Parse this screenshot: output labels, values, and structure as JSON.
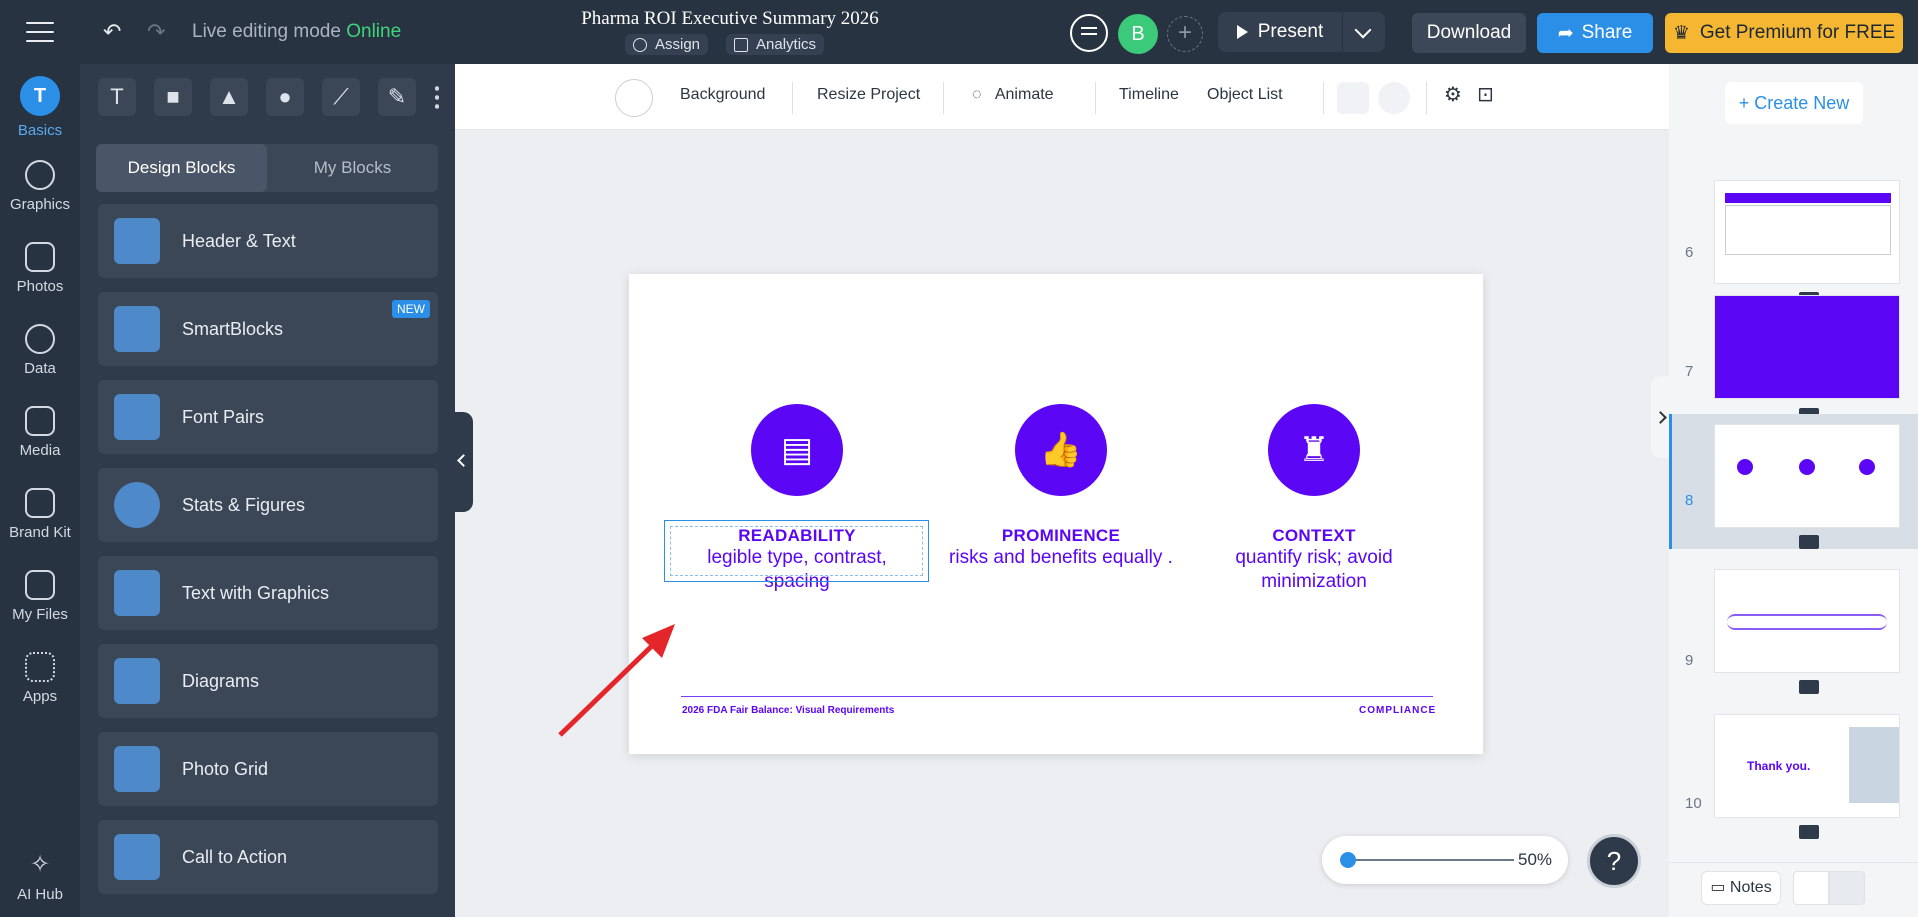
{
  "topbar": {
    "live_label": "Live editing mode",
    "live_status": "Online",
    "project_title": "Pharma ROI Executive Summary 2026",
    "assign": "Assign",
    "analytics": "Analytics",
    "avatar_initial": "B",
    "present": "Present",
    "download": "Download",
    "share": "Share",
    "premium": "Get Premium for FREE"
  },
  "rail": [
    {
      "label": "Basics"
    },
    {
      "label": "Graphics"
    },
    {
      "label": "Photos"
    },
    {
      "label": "Data"
    },
    {
      "label": "Media"
    },
    {
      "label": "Brand Kit"
    },
    {
      "label": "My Files"
    },
    {
      "label": "Apps"
    },
    {
      "label": "AI Hub"
    }
  ],
  "panel": {
    "tabs": [
      "Design Blocks",
      "My Blocks"
    ],
    "blocks": [
      "Header & Text",
      "SmartBlocks",
      "Font Pairs",
      "Stats & Figures",
      "Text with Graphics",
      "Diagrams",
      "Photo Grid",
      "Call to Action"
    ],
    "new_badge": "NEW"
  },
  "canvas_toolbar": {
    "background": "Background",
    "resize": "Resize Project",
    "animate": "Animate",
    "timeline": "Timeline",
    "object_list": "Object List"
  },
  "slide": {
    "columns": [
      {
        "heading": "READABILITY",
        "line1": "legible type, contrast,",
        "line2": "spacing",
        "icon": "document-icon"
      },
      {
        "heading": "PROMINENCE",
        "line1": "risks and benefits equally .",
        "line2": "",
        "icon": "thumbs-up-icon"
      },
      {
        "heading": "CONTEXT",
        "line1": "quantify risk; avoid",
        "line2": "minimization",
        "icon": "chess-rook-icon"
      }
    ],
    "footer_left": "2026 FDA Fair Balance: Visual Requirements",
    "footer_right": "COMPLIANCE",
    "accent": "#5b06f5"
  },
  "zoom": {
    "percent": "50%",
    "value": 0.5
  },
  "right_panel": {
    "create_new": "+ Create New",
    "slides": [
      "6",
      "7",
      "8",
      "9",
      "10"
    ],
    "thank_you": "Thank you.",
    "notes": "Notes"
  }
}
